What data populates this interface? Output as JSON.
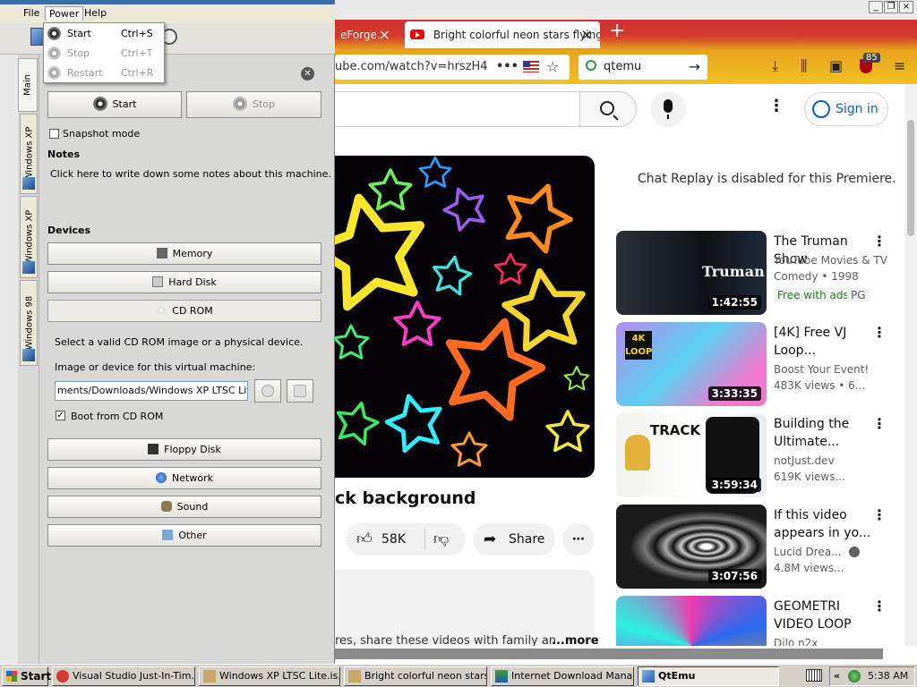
{
  "browser": {
    "tabs": [
      {
        "label": "eForge.",
        "close": "×"
      },
      {
        "label": "Bright colorful neon stars flying in",
        "close": "×"
      }
    ],
    "new_tab": "+",
    "url": "ube.com/watch?v=hrszH4",
    "url_dots": "•••",
    "search_value": "qtemu",
    "badge": "85",
    "window_controls": [
      "_",
      "❐",
      "×"
    ]
  },
  "youtube": {
    "sign_in": "Sign in",
    "video_title": "ck background",
    "likes": "58K",
    "share": "Share",
    "chat_replay": "Chat Replay is disabled for this Premiere.",
    "description_text": "res, share these videos with family an",
    "description_more": "...more",
    "recommendations": [
      {
        "title": "The Truman Show",
        "channel": "YouTube Movies & TV",
        "meta": "Comedy • 1998",
        "duration": "1:42:55",
        "badge": "Free with ads",
        "rating": "PG",
        "thumb_text": "Truman"
      },
      {
        "title": "[4K] Free VJ Loop...",
        "channel": "Boost Your Event!",
        "meta": "483K views  • 6...",
        "duration": "3:33:35",
        "thumb_text": "4K LOOP"
      },
      {
        "title": "Building the Ultimate...",
        "channel": "notJust.dev",
        "meta": "619K views...",
        "duration": "3:59:34",
        "thumb_text": "TRACK"
      },
      {
        "title": "If this video appears in yo...",
        "channel": "Lucid Drea...",
        "meta": "4.8M views...",
        "duration": "3:07:56"
      },
      {
        "title": "GEOMETRI VIDEO LOOP",
        "channel": "Dilo n2x",
        "meta": ""
      }
    ]
  },
  "qtemu": {
    "menu": [
      "File",
      "Power",
      "Help"
    ],
    "power_menu": [
      {
        "label": "Start",
        "shortcut": "Ctrl+S",
        "enabled": true
      },
      {
        "label": "Stop",
        "shortcut": "Ctrl+T",
        "enabled": false
      },
      {
        "label": "Restart",
        "shortcut": "Ctrl+R",
        "enabled": false
      }
    ],
    "side_tabs": [
      "Main",
      "Windows XP",
      "Windows XP",
      "Windows 98"
    ],
    "start_label": "Start",
    "stop_label": "Stop",
    "snapshot_label": "Snapshot mode",
    "notes_heading": "Notes",
    "notes_text": "Click here to write down some notes about this machine.",
    "devices_heading": "Devices",
    "devices": [
      "Memory",
      "Hard Disk",
      "CD ROM",
      "Floppy Disk",
      "Network",
      "Sound",
      "Other"
    ],
    "cdrom_hint": "Select a valid CD ROM image or a physical device.",
    "image_label": "Image or device for this virtual machine:",
    "image_value": "ments/Downloads/Windows XP LTSC Lite.iso",
    "boot_label": "Boot from CD ROM",
    "boot_checked": true,
    "snapshot_checked": false
  },
  "taskbar": {
    "start": "Start",
    "tasks": [
      "Visual Studio Just-In-Tim...",
      "Windows XP LTSC Lite.is...",
      "Bright colorful neon stars...",
      "Internet Download Mana...",
      "QtEmu"
    ],
    "tray_chevron": "«",
    "clock": "5:38 AM"
  },
  "colors": {
    "youtube_red": "#ff0000",
    "link_blue": "#065fd4",
    "xp_gray": "#d4d0c8"
  }
}
